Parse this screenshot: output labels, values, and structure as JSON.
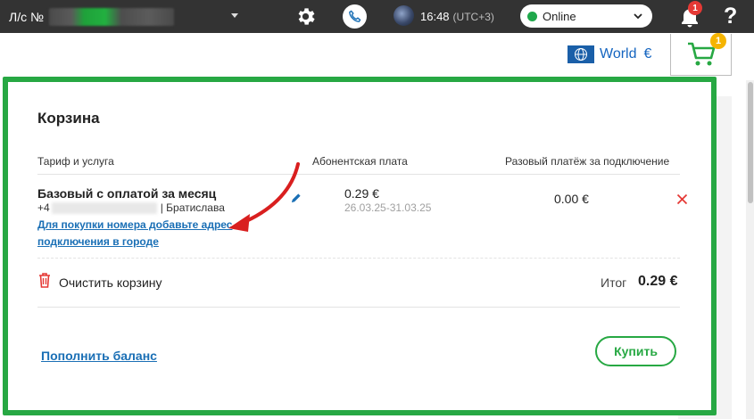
{
  "topbar": {
    "account_label": "Л/с №",
    "time": "16:48",
    "timezone": "(UTC+3)",
    "status": "Online",
    "notification_count": "1",
    "help": "?"
  },
  "header": {
    "region": "World",
    "currency": "€",
    "cart_count": "1"
  },
  "cart": {
    "title": "Корзина",
    "columns": {
      "service": "Тариф и услуга",
      "subscription": "Абонентская плата",
      "one_time": "Разовый платёж за подключение"
    },
    "item": {
      "name": "Базовый с оплатой за месяц",
      "number_prefix": "+4",
      "city": "| Братислава",
      "address_link": "Для покупки номера добавьте адрес подключения в городе",
      "fee": "0.29 €",
      "period": "26.03.25-31.03.25",
      "one_time_fee": "0.00 €"
    },
    "clear_label": "Очистить корзину",
    "total_label": "Итог",
    "total_value": "0.29 €",
    "topup_link": "Пополнить баланс",
    "buy_button": "Купить"
  },
  "colors": {
    "highlight_green": "#27a843",
    "link_blue": "#1a6fb5",
    "topbar": "#333333",
    "danger": "#e53935",
    "badge_yellow": "#f5b400"
  },
  "icons": [
    "gear-icon",
    "phone-icon",
    "avatar",
    "chevron-down-icon",
    "bell-icon",
    "help-icon",
    "globe-icon",
    "cart-icon",
    "pencil-icon",
    "close-icon",
    "trash-icon",
    "arrow-annotation"
  ]
}
